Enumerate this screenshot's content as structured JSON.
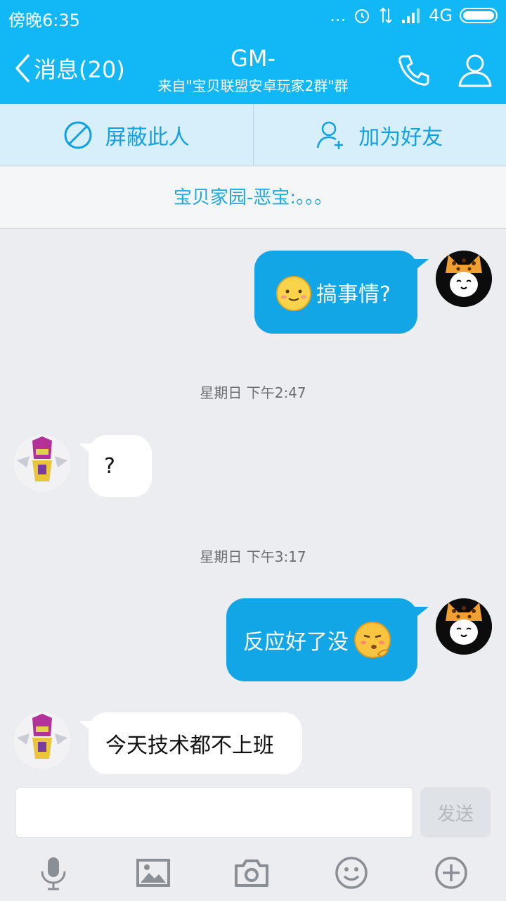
{
  "status_bar": {
    "time": "傍晚6:35",
    "network": "4G",
    "dots": "..."
  },
  "header": {
    "back_label": "消息(20)",
    "title": "GM-",
    "subtitle": "来自\"宝贝联盟安卓玩家2群\"群"
  },
  "actions": {
    "block_label": "屏蔽此人",
    "add_friend_label": "加为好友"
  },
  "notice": {
    "text": "宝贝家园-恶宝:。。。"
  },
  "messages": {
    "m1": {
      "text": "搞事情?",
      "direction": "out"
    },
    "ts1": "星期日 下午2:47",
    "m2": {
      "text": "?",
      "direction": "in"
    },
    "ts2": "星期日 下午3:17",
    "m3": {
      "text": "反应好了没",
      "direction": "out"
    },
    "m4": {
      "text": "今天技术都不上班",
      "direction": "in"
    }
  },
  "composer": {
    "placeholder": "",
    "send_label": "发送"
  },
  "toolbar": {
    "icons": [
      "microphone-icon",
      "image-icon",
      "camera-icon",
      "emoji-icon",
      "plus-icon"
    ]
  },
  "colors": {
    "brand": "#12b7f5",
    "bubble_out": "#12a6e6",
    "bubble_in": "#ffffff",
    "background": "#ebedf0"
  }
}
